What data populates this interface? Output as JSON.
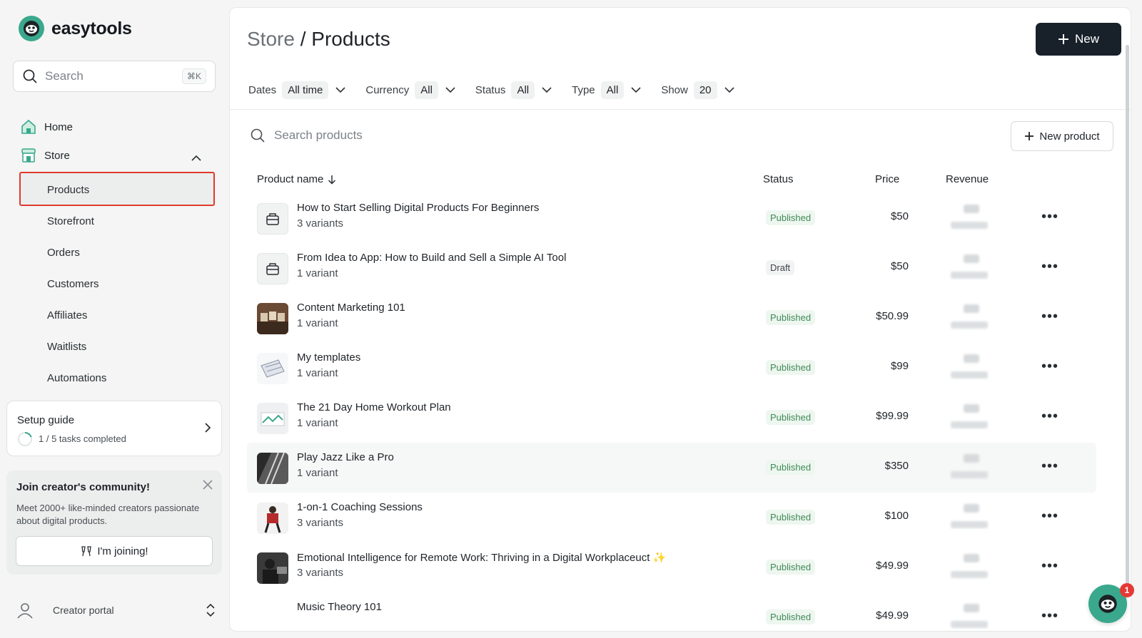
{
  "brand": {
    "name": "easytools"
  },
  "sidebar": {
    "search_placeholder": "Search",
    "search_shortcut": "⌘K",
    "home_label": "Home",
    "store_label": "Store",
    "store_items": [
      {
        "label": "Products"
      },
      {
        "label": "Storefront"
      },
      {
        "label": "Orders"
      },
      {
        "label": "Customers"
      },
      {
        "label": "Affiliates"
      },
      {
        "label": "Waitlists"
      },
      {
        "label": "Automations"
      }
    ],
    "setup_guide": {
      "title": "Setup guide",
      "progress_text": "1 / 5 tasks completed",
      "completed": 1,
      "total": 5
    },
    "community": {
      "title": "Join creator's community!",
      "text": "Meet 2000+ like-minded creators passionate about digital products.",
      "button_label": "I'm joining!"
    },
    "portal_label": "Creator portal"
  },
  "main": {
    "breadcrumb_parent": "Store",
    "breadcrumb_sep": "/",
    "breadcrumb_current": "Products",
    "new_button_label": "New",
    "filters": [
      {
        "label": "Dates",
        "value": "All time"
      },
      {
        "label": "Currency",
        "value": "All"
      },
      {
        "label": "Status",
        "value": "All"
      },
      {
        "label": "Type",
        "value": "All"
      },
      {
        "label": "Show",
        "value": "20"
      }
    ],
    "search_placeholder": "Search products",
    "new_product_label": "New product",
    "columns": {
      "name": "Product name",
      "status": "Status",
      "price": "Price",
      "revenue": "Revenue"
    },
    "products": [
      {
        "name": "How to Start Selling Digital Products For Beginners",
        "variants": "3 variants",
        "status": "Published",
        "price": "$50",
        "thumb": "box-icon"
      },
      {
        "name": "From Idea to App: How to Build and Sell a Simple AI Tool",
        "variants": "1 variant",
        "status": "Draft",
        "price": "$50",
        "thumb": "box-icon"
      },
      {
        "name": "Content Marketing 101",
        "variants": "1 variant",
        "status": "Published",
        "price": "$50.99",
        "thumb": "seo-photo"
      },
      {
        "name": "My templates",
        "variants": "1 variant",
        "status": "Published",
        "price": "$99",
        "thumb": "template-photo"
      },
      {
        "name": "The 21 Day Home Workout Plan",
        "variants": "1 variant",
        "status": "Published",
        "price": "$99.99",
        "thumb": "workout-photo"
      },
      {
        "name": "Play Jazz Like a Pro",
        "variants": "1 variant",
        "status": "Published",
        "price": "$350",
        "thumb": "piano-photo"
      },
      {
        "name": "1-on-1 Coaching Sessions",
        "variants": "3 variants",
        "status": "Published",
        "price": "$100",
        "thumb": "coaching-photo"
      },
      {
        "name": "Emotional Intelligence for Remote Work: Thriving in a Digital Workplaceuct ✨",
        "variants": "3 variants",
        "status": "Published",
        "price": "$49.99",
        "thumb": "remote-photo"
      },
      {
        "name": "Music Theory 101",
        "variants": "",
        "status": "Published",
        "price": "$49.99",
        "thumb": "none"
      }
    ]
  },
  "chat": {
    "badge_count": "1"
  },
  "colors": {
    "accent": "#3aa88d",
    "dark_button": "#18212a",
    "published_text": "#3f8a56",
    "highlight_border": "#e0392e"
  }
}
